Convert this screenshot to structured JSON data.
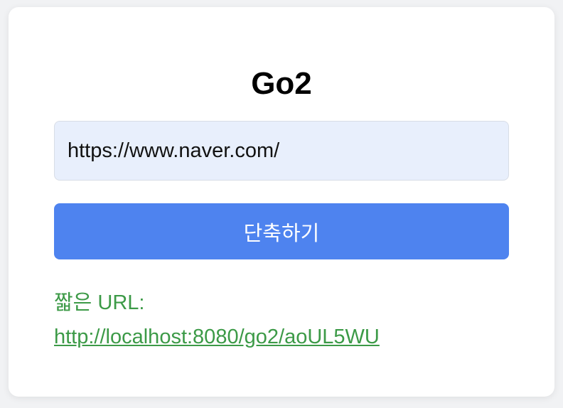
{
  "app": {
    "title": "Go2"
  },
  "form": {
    "url_value": "https://www.naver.com/",
    "submit_label": "단축하기"
  },
  "result": {
    "label": "짧은 URL:",
    "short_url": "http://localhost:8080/go2/aoUL5WU"
  },
  "colors": {
    "background": "#f1f2f4",
    "card": "#ffffff",
    "input_bg": "#e8effc",
    "button": "#4e83ef",
    "result_text": "#3c9a47"
  }
}
